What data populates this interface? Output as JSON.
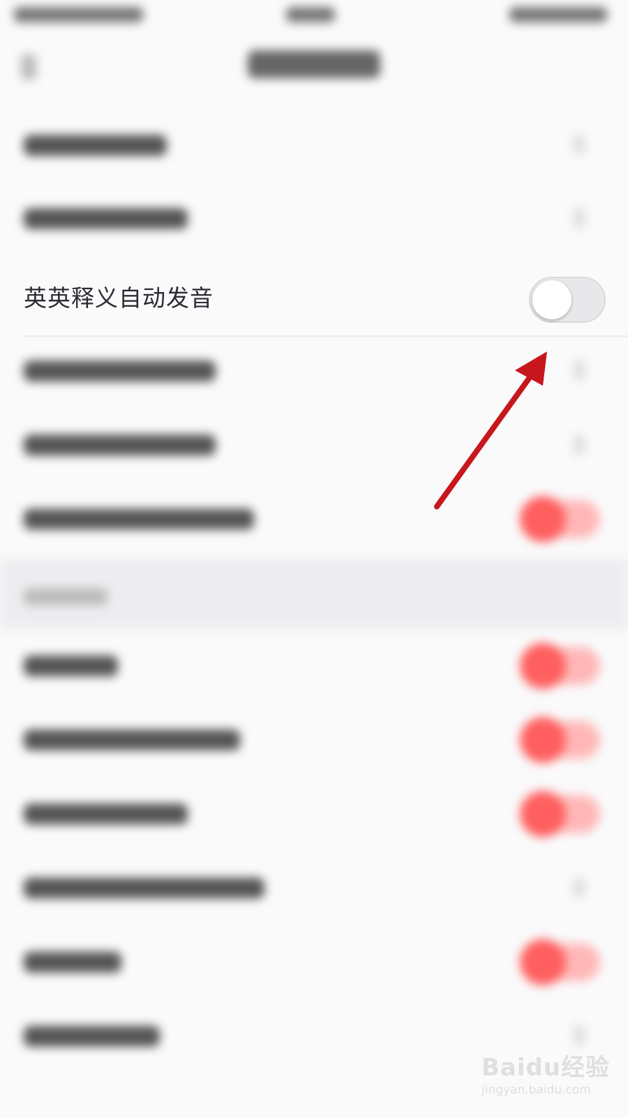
{
  "setting_row": {
    "label": "英英释义自动发音",
    "toggle_state": "off"
  },
  "watermark": {
    "brand": "Baidu经验",
    "url": "jingyan.baidu.com"
  },
  "colors": {
    "arrow": "#c8161d",
    "toggle_track": "#e8e8eb",
    "blurred_toggle_on": "#ff5f5f"
  },
  "icons": [
    "back-arrow-icon",
    "chevron-right-icon",
    "pointer-arrow-icon"
  ]
}
